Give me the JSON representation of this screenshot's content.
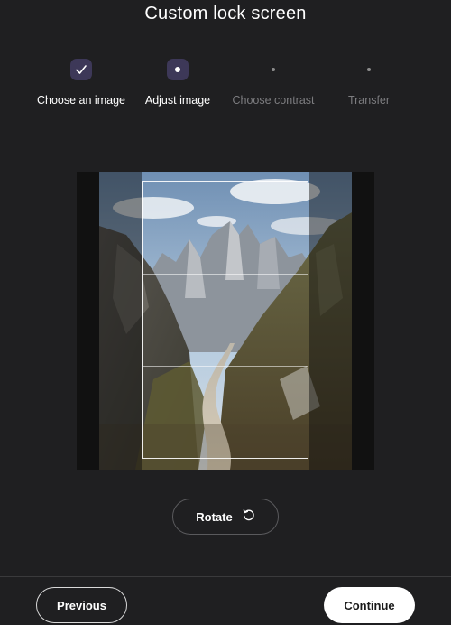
{
  "header": {
    "title": "Custom lock screen"
  },
  "stepper": {
    "steps": [
      {
        "label": "Choose an image",
        "state": "done"
      },
      {
        "label": "Adjust image",
        "state": "active"
      },
      {
        "label": "Choose contrast",
        "state": "pending"
      },
      {
        "label": "Transfer",
        "state": "pending"
      }
    ]
  },
  "editor": {
    "rotate_label": "Rotate",
    "rotate_icon": "rotate-ccw-icon"
  },
  "footer": {
    "previous_label": "Previous",
    "continue_label": "Continue"
  },
  "colors": {
    "background": "#1f1f21",
    "step_active_bg": "#3d3858",
    "pending_text": "#7d7d80"
  }
}
